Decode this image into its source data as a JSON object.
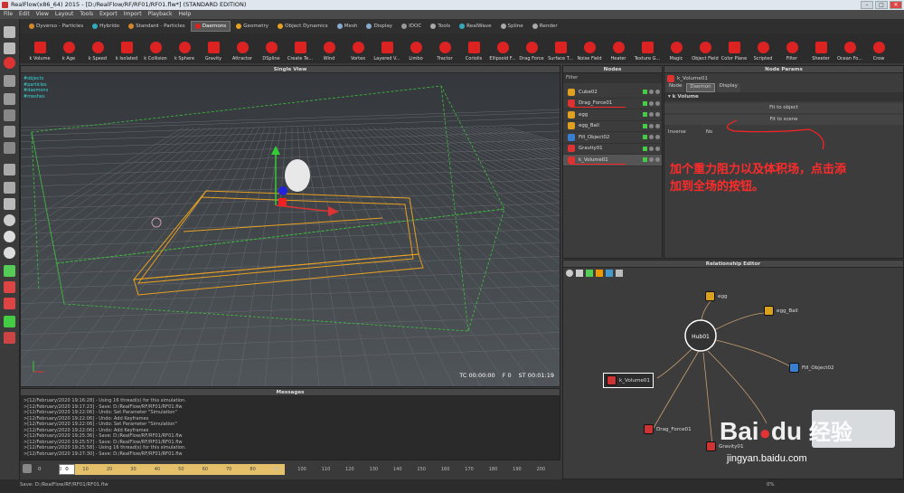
{
  "window": {
    "title": "RealFlow(x86_64) 2015 - [D:/RealFlow/RF/RF01/RF01.flw*] (STANDARD EDITION)",
    "min": "–",
    "max": "□",
    "close": "✕"
  },
  "menu": [
    "File",
    "Edit",
    "View",
    "Layout",
    "Tools",
    "Export",
    "Import",
    "Playback",
    "Help"
  ],
  "tabs": [
    "Dyverso - Particles",
    "Hybrido",
    "Standard - Particles",
    "Daemons",
    "Geometry",
    "Object Dynamics",
    "Mesh",
    "Display",
    "IDOC",
    "Tools",
    "RealWave",
    "Spline",
    "Render"
  ],
  "active_tab": "Daemons",
  "tools": [
    {
      "label": "k Volume",
      "color": "#d22"
    },
    {
      "label": "k Age",
      "color": "#d22"
    },
    {
      "label": "k Speed",
      "color": "#d22"
    },
    {
      "label": "k Isolated",
      "color": "#d22"
    },
    {
      "label": "k Collision",
      "color": "#d22"
    },
    {
      "label": "k Sphere",
      "color": "#d22"
    },
    {
      "label": "Gravity",
      "color": "#d22"
    },
    {
      "label": "Attractor",
      "color": "#d22"
    },
    {
      "label": "DSpline",
      "color": "#d22"
    },
    {
      "label": "Create Te...",
      "color": "#d22"
    },
    {
      "label": "Wind",
      "color": "#d22"
    },
    {
      "label": "Vortex",
      "color": "#d22"
    },
    {
      "label": "Layered V...",
      "color": "#d22"
    },
    {
      "label": "Limbo",
      "color": "#d22"
    },
    {
      "label": "Tractor",
      "color": "#d22"
    },
    {
      "label": "Coriolis",
      "color": "#d22"
    },
    {
      "label": "Ellipsoid F...",
      "color": "#d22"
    },
    {
      "label": "Drag Force",
      "color": "#d22"
    },
    {
      "label": "Surface T...",
      "color": "#d22"
    },
    {
      "label": "Noise Field",
      "color": "#d22"
    },
    {
      "label": "Heater",
      "color": "#d22"
    },
    {
      "label": "Texture G...",
      "color": "#d22"
    },
    {
      "label": "Magic",
      "color": "#d22"
    },
    {
      "label": "Object Field",
      "color": "#d22"
    },
    {
      "label": "Color Plane",
      "color": "#d22"
    },
    {
      "label": "Scripted",
      "color": "#d22"
    },
    {
      "label": "Filter",
      "color": "#d22"
    },
    {
      "label": "Sheeter",
      "color": "#d22"
    },
    {
      "label": "Ocean Fo...",
      "color": "#d22"
    },
    {
      "label": "Crow",
      "color": "#d22"
    }
  ],
  "viewport": {
    "title": "Single View",
    "info": [
      "#objects",
      "#particles",
      "#daemons",
      "#meshes"
    ],
    "tc": "TC 00:00:00",
    "frame": "F 0",
    "st": "ST 00:01:19"
  },
  "messages": {
    "title": "Messages",
    "lines": [
      ">[12/February/2020 19:16:28] - Using 16 thread(s) for this simulation.",
      ">[12/February/2020 19:17:23] - Save: D:/RealFlow/RF/RF01/RF01.flw",
      ">[12/February/2020 19:22:06] - Undo: Set Parameter \"Simulation\"",
      ">[12/February/2020 19:22:06] - Undo: Add Keyframes",
      ">[12/February/2020 19:22:06] - Undo: Set Parameter \"Simulation\"",
      ">[12/February/2020 19:22:06] - Undo: Add Keyframes",
      ">[12/February/2020 19:25:36] - Save: D:/RealFlow/RF/RF01/RF01.flw",
      ">[12/February/2020 19:25:57] - Save: D:/RealFlow/RF/RF01/RF01.flw",
      ">[12/February/2020 19:25:58] - Using 16 thread(s) for this simulation.",
      ">[12/February/2020 19:27:30] - Save: D:/RealFlow/RF/RF01/RF01.flw"
    ]
  },
  "timeline": {
    "start": "0",
    "current": "0",
    "ticks": [
      "0",
      "10",
      "20",
      "30",
      "40",
      "50",
      "60",
      "70",
      "80",
      "90",
      "100",
      "110",
      "120",
      "130",
      "140",
      "150",
      "160",
      "170",
      "180",
      "190",
      "200"
    ],
    "end": "200"
  },
  "statusbar": {
    "text": "Save: D:/RealFlow/RF/RF01/RF01.flw",
    "pct": "0%"
  },
  "nodes": {
    "title": "Nodes",
    "filter": "Filter",
    "items": [
      {
        "label": "Cube02",
        "color": "#e0a020"
      },
      {
        "label": "Drag_Force01",
        "color": "#d33"
      },
      {
        "label": "egg",
        "color": "#e0a020"
      },
      {
        "label": "egg_Ball",
        "color": "#e0a020"
      },
      {
        "label": "Fill_Object02",
        "color": "#3a7ed0"
      },
      {
        "label": "Gravity01",
        "color": "#d33"
      },
      {
        "label": "k_Volume01",
        "color": "#d33"
      }
    ]
  },
  "nodeparams": {
    "title": "Node Params",
    "node": "k_Volume01",
    "tabs": [
      "Node",
      "Daemon",
      "Display"
    ],
    "active": "Daemon",
    "section": "k Volume",
    "fit_object": "Fit to object",
    "fit_scene": "Fit to scene",
    "inverse_label": "Inverse",
    "inverse_value": "No"
  },
  "annotation": [
    "加个重力阻力以及体积场，点击添",
    "加到全场的按钮。"
  ],
  "relation": {
    "title": "Relationship Editor",
    "hub": "Hub01",
    "nodes": [
      {
        "label": "egg",
        "color": "#d9a21e"
      },
      {
        "label": "egg_Ball",
        "color": "#d9a21e"
      },
      {
        "label": "Fill_Object02",
        "color": "#3a7ed0"
      },
      {
        "label": "k_Volume01",
        "color": "#cc3333"
      },
      {
        "label": "Drag_Force01",
        "color": "#cc3333"
      },
      {
        "label": "Gravity01",
        "color": "#cc3333"
      }
    ]
  },
  "watermark": {
    "brand": "Bai",
    "brand2": "du",
    "cn": "经验",
    "url": "jingyan.baidu.com"
  }
}
